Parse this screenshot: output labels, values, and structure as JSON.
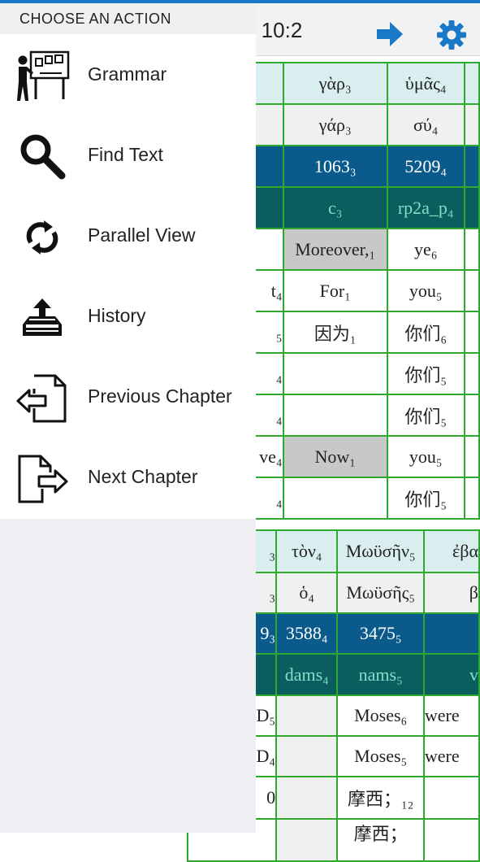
{
  "header": {
    "title_fragment": "n 10:2"
  },
  "grid1": {
    "rows": [
      [
        "",
        "γὰρ₃",
        "ὑμᾶς₄"
      ],
      [
        "",
        "γάρ₃",
        "σύ₄"
      ],
      [
        "",
        "1063₃",
        "5209₄"
      ],
      [
        "",
        "c₃",
        "rp2a_p₄"
      ],
      [
        "",
        "Moreover,₁",
        "ye₆"
      ],
      [
        "t₄",
        "For₁",
        "you₅"
      ],
      [
        "₅",
        "因为₁",
        "你们₆"
      ],
      [
        "₄",
        "",
        "你们₅"
      ],
      [
        "₄",
        "",
        "你们₅"
      ],
      [
        "ve₄",
        "Now₁",
        "you₅"
      ],
      [
        "₄",
        "",
        "你们₅"
      ]
    ]
  },
  "grid2": {
    "rows": [
      [
        "₃",
        "τὸν₄",
        "Μωϋσῆν₅",
        "ἐβα"
      ],
      [
        "₃",
        "ὁ₄",
        "Μωϋσῆς₅",
        "β"
      ],
      [
        "9₃",
        "3588₄",
        "3475₅",
        ""
      ],
      [
        "",
        "dams₄",
        "nams₅",
        "v"
      ],
      [
        "D₅",
        "",
        "Moses₆",
        "were"
      ],
      [
        "D₄",
        "",
        "Moses₅",
        "were"
      ],
      [
        "0",
        "",
        "摩西；₁₂",
        ""
      ],
      [
        "",
        "",
        "摩西；",
        ""
      ]
    ]
  },
  "menu": {
    "heading": "CHOOSE AN ACTION",
    "items": [
      {
        "label": "Grammar",
        "icon": "teacher-icon"
      },
      {
        "label": "Find Text",
        "icon": "search-icon"
      },
      {
        "label": "Parallel View",
        "icon": "sync-icon"
      },
      {
        "label": "History",
        "icon": "history-tray-icon"
      },
      {
        "label": "Previous Chapter",
        "icon": "previous-page-icon"
      },
      {
        "label": "Next Chapter",
        "icon": "next-page-icon"
      }
    ]
  },
  "colors": {
    "accent": "#1979c8",
    "grid_border": "#2ea82e",
    "strong_row": "#0b5a8c",
    "morph_row": "#0b5e5e"
  }
}
